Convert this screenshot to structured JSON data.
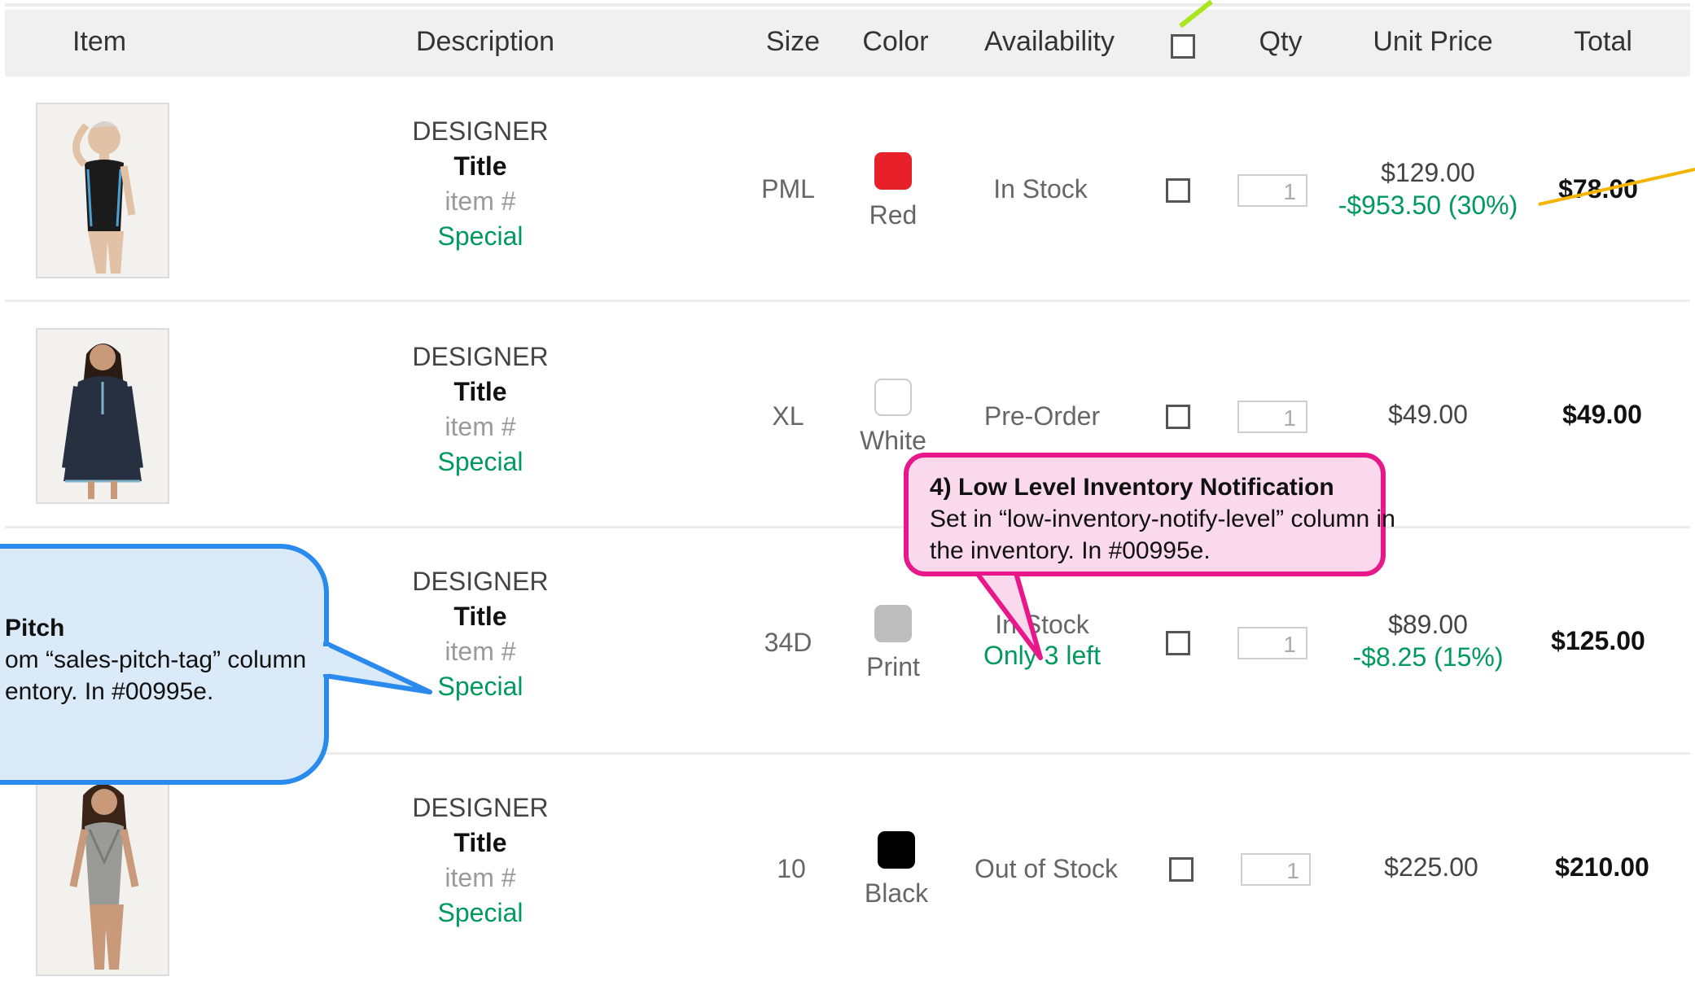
{
  "header": {
    "item": "Item",
    "description": "Description",
    "size": "Size",
    "color": "Color",
    "availability": "Availability",
    "qty": "Qty",
    "unit_price": "Unit Price",
    "total": "Total"
  },
  "rows": [
    {
      "designer": "DESIGNER",
      "title": "Title",
      "item_no": "item #",
      "special": "Special",
      "size": "PML",
      "color_name": "Red",
      "color_hex": "#e8202a",
      "availability": "In Stock",
      "low_inventory": "",
      "qty": "1",
      "unit_price": "$129.00",
      "discount": "-$953.50 (30%)",
      "total": "$78.00",
      "image_icon": "model-black-swimsuit-photo"
    },
    {
      "designer": "DESIGNER",
      "title": "Title",
      "item_no": "item #",
      "special": "Special",
      "size": "XL",
      "color_name": "White",
      "color_hex": "#ffffff",
      "availability": "Pre-Order",
      "low_inventory": "",
      "qty": "1",
      "unit_price": "$49.00",
      "discount": "",
      "total": "$49.00",
      "image_icon": "model-navy-tunic-photo"
    },
    {
      "designer": "DESIGNER",
      "title": "Title",
      "item_no": "item #",
      "special": "Special",
      "size": "34D",
      "color_name": "Print",
      "color_hex": "#bdbdbd",
      "availability": "In Stock",
      "low_inventory": "Only 3 left",
      "qty": "1",
      "unit_price": "$89.00",
      "discount": "-$8.25 (15%)",
      "total": "$125.00",
      "image_icon": "model-print-swimsuit-photo"
    },
    {
      "designer": "DESIGNER",
      "title": "Title",
      "item_no": "item #",
      "special": "Special",
      "size": "10",
      "color_name": "Black",
      "color_hex": "#000000",
      "availability": "Out of Stock",
      "low_inventory": "",
      "qty": "1",
      "unit_price": "$225.00",
      "discount": "",
      "total": "$210.00",
      "image_icon": "model-grey-swimsuit-photo"
    }
  ],
  "callouts": {
    "low_inventory": {
      "title": "4) Low Level Inventory Notification",
      "line1": "Set in “low-inventory-notify-level” column in",
      "line2": "the inventory. In #00995e."
    },
    "sales_pitch": {
      "title": "Pitch",
      "line1": "om “sales-pitch-tag” column",
      "line2": "entory. In #00995e."
    }
  },
  "colors": {
    "special_green": "#00995e",
    "callout_pink_border": "#e8188a",
    "callout_pink_fill": "#fbd9ec",
    "callout_blue_border": "#2a8aee",
    "callout_blue_fill": "#dbeaf8",
    "arrow_lime": "#a8e61d",
    "arrow_orange": "#f5b400"
  }
}
